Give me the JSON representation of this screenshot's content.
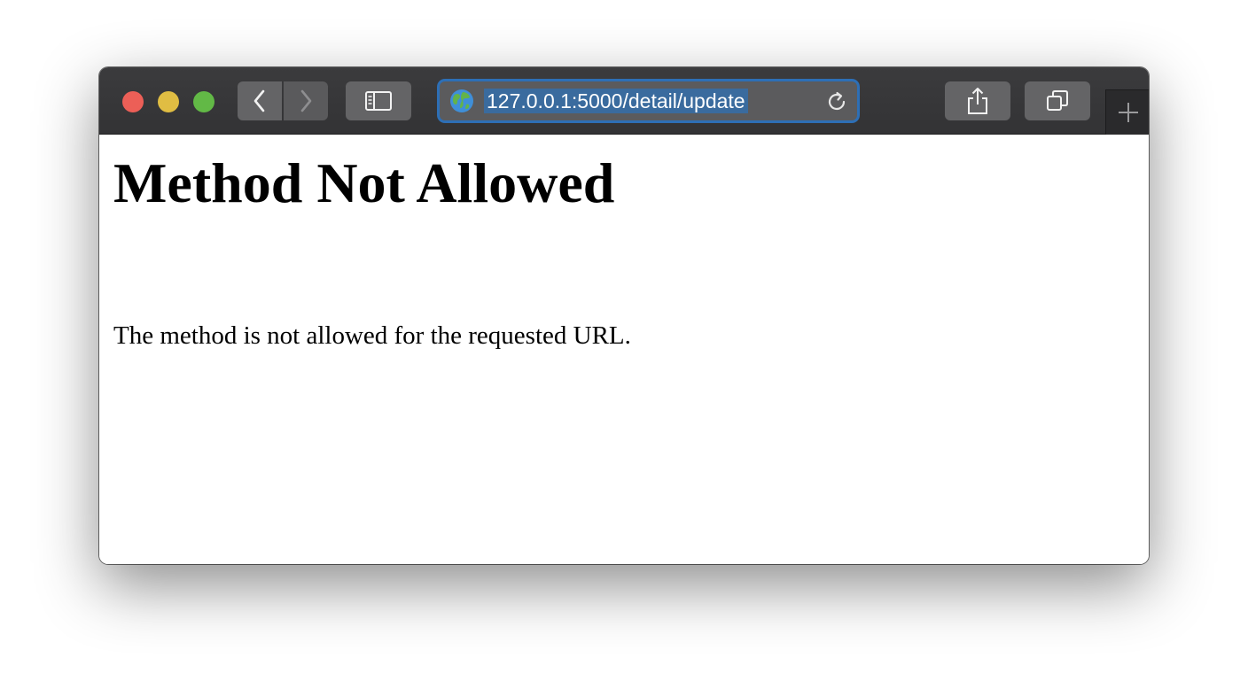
{
  "browser": {
    "address_bar": {
      "url": "127.0.0.1:5000/detail/update"
    },
    "icons": {
      "back": "chevron-left-icon",
      "forward": "chevron-right-icon",
      "sidebar": "sidebar-icon",
      "site": "globe-icon",
      "reload": "reload-icon",
      "share": "share-icon",
      "tabs": "tabs-overview-icon",
      "new_tab": "plus-icon"
    },
    "colors": {
      "toolbar": "#363638",
      "address_focus": "#2d6fb6",
      "close": "#ec5f57",
      "minimize": "#e0bd43",
      "zoom": "#62b946"
    }
  },
  "page": {
    "title": "Method Not Allowed",
    "message": "The method is not allowed for the requested URL."
  }
}
